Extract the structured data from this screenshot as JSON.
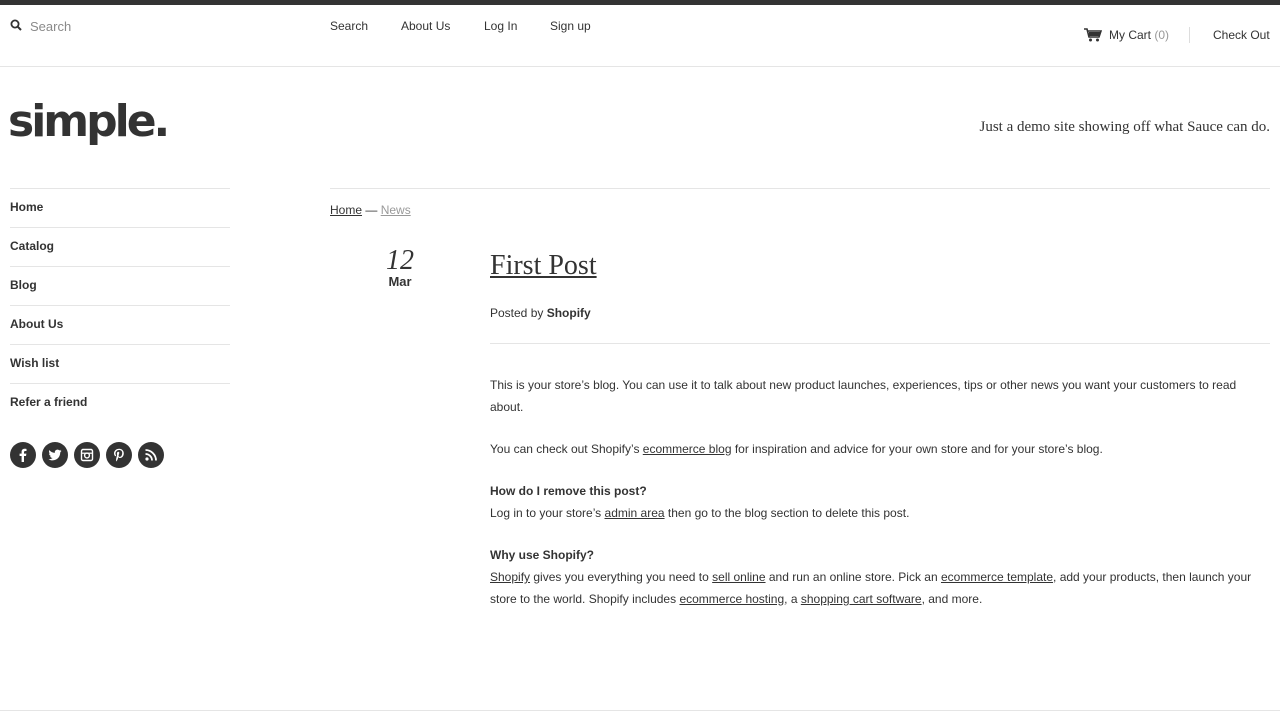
{
  "header": {
    "search_placeholder": "Search",
    "nav": [
      "Search",
      "About Us",
      "Log In",
      "Sign up"
    ],
    "cart_label": "My Cart",
    "cart_count": "(0)",
    "checkout_label": "Check Out"
  },
  "brand": {
    "logo_text": "simple.",
    "tagline": "Just a demo site showing off what Sauce can do."
  },
  "sidebar": {
    "items": [
      {
        "label": "Home"
      },
      {
        "label": "Catalog"
      },
      {
        "label": "Blog"
      },
      {
        "label": "About Us"
      },
      {
        "label": "Wish list"
      },
      {
        "label": "Refer a friend"
      }
    ],
    "socials": [
      "facebook-icon",
      "twitter-icon",
      "instagram-icon",
      "pinterest-icon",
      "rss-icon"
    ]
  },
  "breadcrumb": {
    "home": "Home",
    "separator": " — ",
    "current": "News"
  },
  "post": {
    "day": "12",
    "month": "Mar",
    "title": "First Post",
    "posted_by_label": "Posted by",
    "author": "Shopify",
    "p1": "This is your store’s blog. You can use it to talk about new product launches, experiences, tips or other news you want your customers to read about.",
    "p2_before": "You can check out Shopify’s ",
    "p2_link": "ecommerce blog",
    "p2_after": " for inspiration and advice for your own store and for your store’s blog.",
    "h1": "How do I remove this post?",
    "p3_before": "Log in to your store’s ",
    "p3_link": "admin area",
    "p3_after": " then go to the blog section to delete this post.",
    "h2": "Why use Shopify?",
    "p4_link1": "Shopify",
    "p4_t1": " gives you everything you need to ",
    "p4_link2": "sell online",
    "p4_t2": " and run an online store. Pick an ",
    "p4_link3": "ecommerce template",
    "p4_t3": ", add your products, then launch your store to the world. Shopify includes ",
    "p4_link4": "ecommerce hosting",
    "p4_t4": ", a ",
    "p4_link5": "shopping cart software",
    "p4_t5": ", and more."
  },
  "colors": {
    "text": "#333333",
    "muted": "#999999",
    "rule": "#e5e5e5"
  }
}
